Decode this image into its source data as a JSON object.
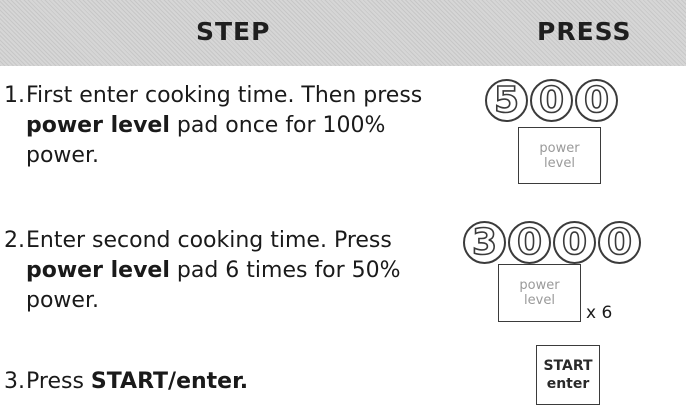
{
  "header": {
    "step_label": "STEP",
    "press_label": "PRESS"
  },
  "steps": [
    {
      "number": "1.",
      "text_a": "First enter cooking time. Then press ",
      "bold": "power level",
      "text_b": " pad once for 100% power.",
      "digits": [
        "5",
        "0",
        "0"
      ],
      "key": {
        "line1": "power",
        "line2": "level"
      }
    },
    {
      "number": "2.",
      "text_a": "Enter second cooking time. Press ",
      "bold": "power level",
      "text_b": " pad 6 times for 50% power.",
      "digits": [
        "3",
        "0",
        "0",
        "0"
      ],
      "key": {
        "line1": "power",
        "line2": "level"
      },
      "multiplier": "x 6"
    },
    {
      "number": "3.",
      "text_a": "Press ",
      "bold": "START/enter.",
      "text_b": "",
      "key": {
        "line1": "START",
        "line2": "enter"
      }
    }
  ]
}
